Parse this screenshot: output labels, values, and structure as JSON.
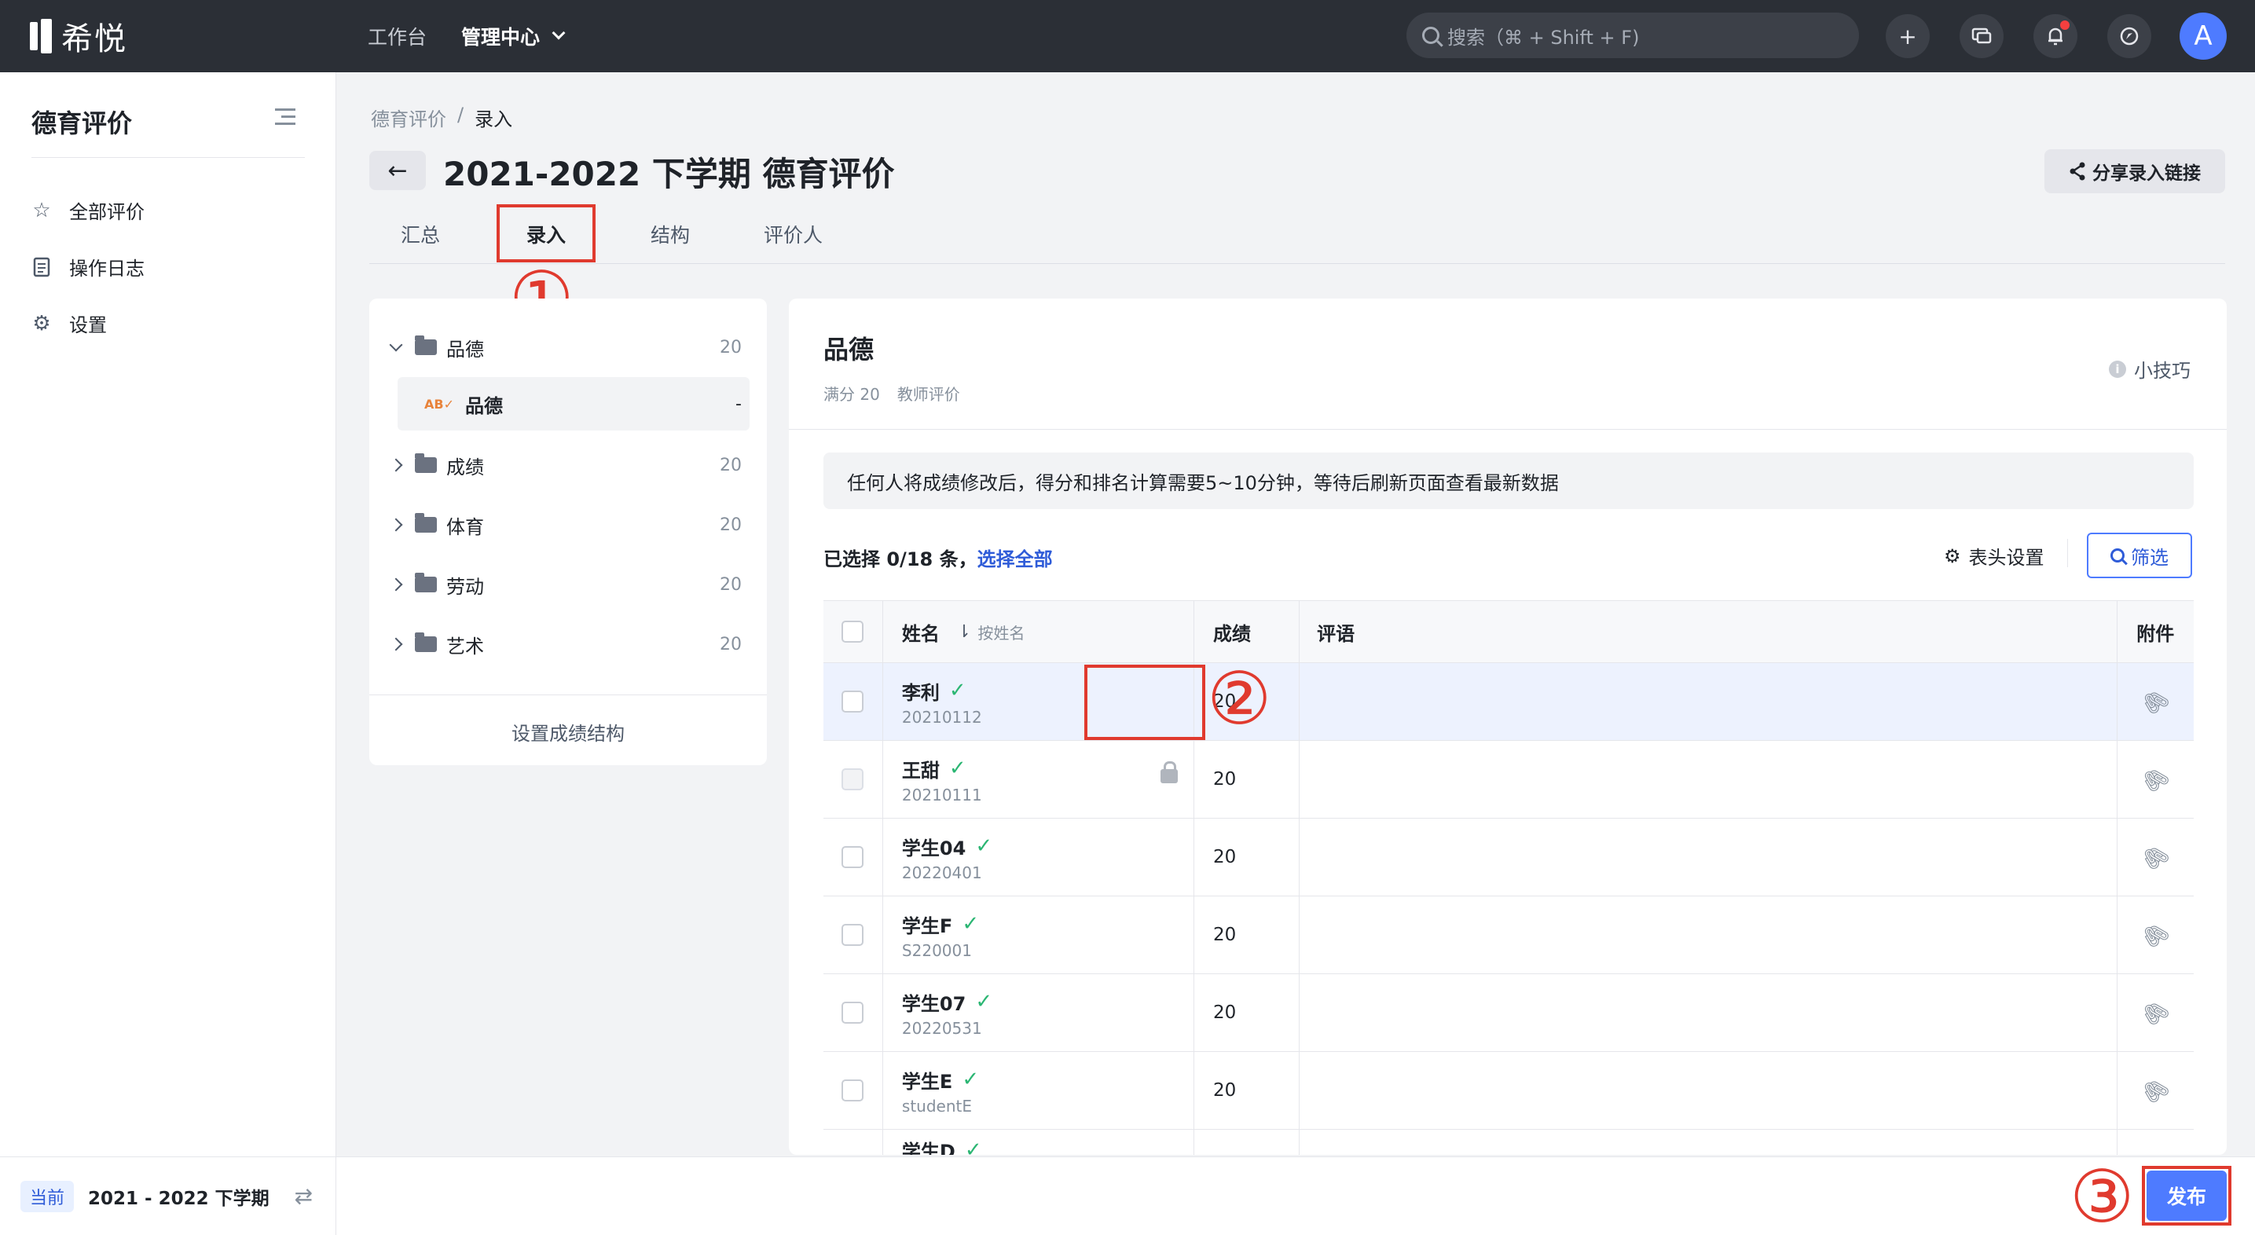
{
  "topbar": {
    "logo_text": "希悦",
    "nav": [
      "工作台",
      "管理中心"
    ],
    "search_placeholder": "搜索（⌘ + Shift + F)",
    "avatar_letter": "A"
  },
  "sidebar": {
    "title": "德育评价",
    "items": [
      {
        "label": "全部评价",
        "icon": "star-icon"
      },
      {
        "label": "操作日志",
        "icon": "log-icon"
      },
      {
        "label": "设置",
        "icon": "gear-icon"
      }
    ],
    "footer_tag": "当前",
    "footer_term": "2021 - 2022 下学期"
  },
  "main": {
    "breadcrumb": [
      "德育评价",
      "/",
      "录入"
    ],
    "title": "2021-2022 下学期 德育评价",
    "share_label": "分享录入链接",
    "tabs": [
      "汇总",
      "录入",
      "结构",
      "评价人"
    ],
    "active_tab": "录入"
  },
  "annotations": [
    "①",
    "②",
    "③"
  ],
  "categories": [
    {
      "label": "品德",
      "count": "20",
      "expanded": true
    },
    {
      "label": "品德",
      "count": "-",
      "sub": true
    },
    {
      "label": "成绩",
      "count": "20"
    },
    {
      "label": "体育",
      "count": "20"
    },
    {
      "label": "劳动",
      "count": "20"
    },
    {
      "label": "艺术",
      "count": "20"
    }
  ],
  "category_footer": "设置成绩结构",
  "panel": {
    "title": "品德",
    "full_score": "满分 20",
    "evaluator": "教师评价",
    "tips": "小技巧",
    "notice": "任何人将成绩修改后，得分和排名计算需要5~10分钟，等待后刷新页面查看最新数据",
    "selected": "已选择 0/18 条，",
    "select_all": "选择全部",
    "header_settings": "表头设置",
    "filter": "筛选"
  },
  "table": {
    "columns": [
      "姓名",
      "按姓名",
      "成绩",
      "评语",
      "附件"
    ],
    "rows": [
      {
        "name": "李利",
        "id": "20210112",
        "score": "20"
      },
      {
        "name": "王甜",
        "id": "20210111",
        "score": "20"
      },
      {
        "name": "学生04",
        "id": "20220401",
        "score": "20"
      },
      {
        "name": "学生F",
        "id": "S220001",
        "score": "20"
      },
      {
        "name": "学生07",
        "id": "20220531",
        "score": "20"
      },
      {
        "name": "学生E",
        "id": "studentE",
        "score": "20"
      },
      {
        "name": "学生D",
        "id": "",
        "score": ""
      }
    ]
  },
  "publish_label": "发布",
  "colors": {
    "topbar": "#2b2f36",
    "accent": "#4e7bff",
    "annotation": "#e03a2e",
    "check": "#2bb673"
  }
}
